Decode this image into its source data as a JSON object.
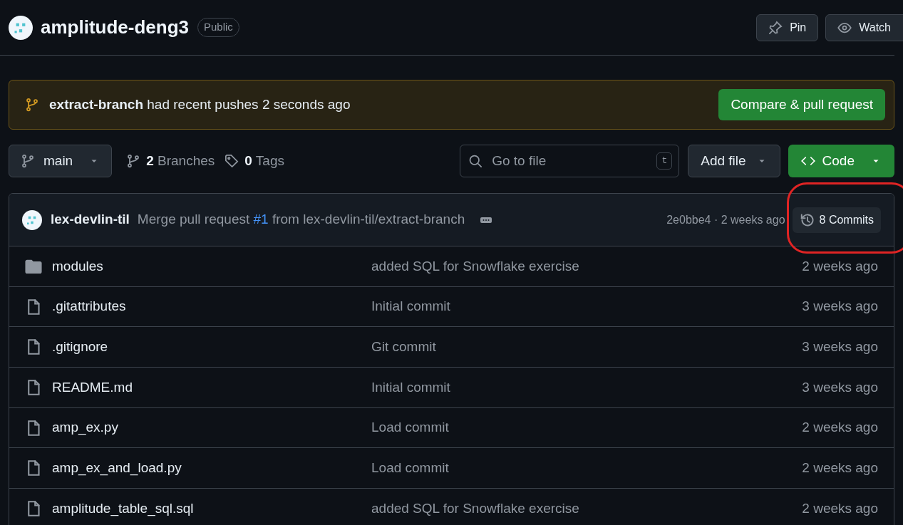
{
  "repo": {
    "name": "amplitude-deng3",
    "visibility": "Public",
    "actions": [
      {
        "kind": "pin",
        "label": "Pin"
      },
      {
        "kind": "watch",
        "label": "Watch"
      }
    ]
  },
  "push_banner": {
    "branch": "extract-branch",
    "message": "had recent pushes 2 seconds ago",
    "button": "Compare & pull request"
  },
  "toolbar": {
    "branch": "main",
    "branches_count": "2",
    "branches_label": "Branches",
    "tags_count": "0",
    "tags_label": "Tags",
    "search": {
      "placeholder": "Go to file",
      "shortcut": "t"
    },
    "add_file": "Add file",
    "code": "Code"
  },
  "latest_commit": {
    "author": "lex-devlin-til",
    "message": "Merge pull request **#1** from lex-devlin-til/extract-branch",
    "sha_time": "2e0bbe4 · 2 weeks ago",
    "commits": "8 Commits"
  },
  "files": [
    {
      "kind": "folder",
      "name": "modules",
      "commit": "added SQL for Snowflake exercise",
      "time": "2 weeks ago"
    },
    {
      "kind": "file",
      "name": ".gitattributes",
      "commit": "Initial commit",
      "time": "3 weeks ago"
    },
    {
      "kind": "file",
      "name": ".gitignore",
      "commit": "Git commit",
      "time": "3 weeks ago"
    },
    {
      "kind": "file",
      "name": "README.md",
      "commit": "Initial commit",
      "time": "3 weeks ago"
    },
    {
      "kind": "file",
      "name": "amp_ex.py",
      "commit": "Load commit",
      "time": "2 weeks ago"
    },
    {
      "kind": "file",
      "name": "amp_ex_and_load.py",
      "commit": "Load commit",
      "time": "2 weeks ago"
    },
    {
      "kind": "file",
      "name": "amplitude_table_sql.sql",
      "commit": "added SQL for Snowflake exercise",
      "time": "2 weeks ago"
    }
  ]
}
